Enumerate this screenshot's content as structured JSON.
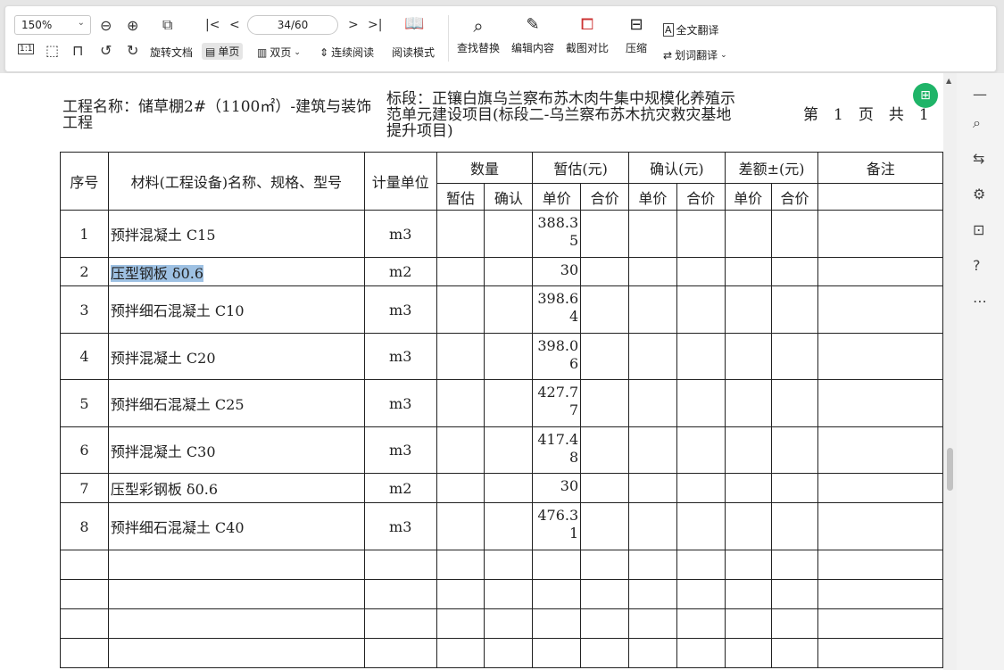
{
  "toolbar": {
    "zoom": "150%",
    "page_indicator": "34/60",
    "row2": {
      "actual_size": "1:1",
      "rotate_doc": "旋转文档",
      "single_page": "单页",
      "double_page": "双页",
      "continuous": "连续阅读",
      "read_mode": "阅读模式"
    },
    "tools": {
      "find_replace": "查找替换",
      "edit_content": "编辑内容",
      "screenshot_compare": "截图对比",
      "compress": "压缩",
      "full_translate": "全文翻译",
      "word_translate": "划词翻译"
    }
  },
  "document": {
    "project_name": "工程名称：储草棚2#（1100㎡）-建筑与装饰工程",
    "project_name_line1": "工程名称：储草棚2#（1100㎡）-建筑与装饰",
    "project_name_line2": "工程",
    "section_line1": "标段：正镶白旗乌兰察布苏木肉牛集中规模化养殖示",
    "section_line2": "范单元建设项目(标段二-乌兰察布苏木抗灾救灾基地",
    "section_line3": "提升项目)",
    "page_info": "第　1　页　共　1",
    "table": {
      "headers": {
        "seq": "序号",
        "material": "材料(工程设备)名称、规格、型号",
        "unit": "计量单位",
        "quantity": "数量",
        "estimate": "暂估(元)",
        "confirm": "确认(元)",
        "difference": "差额±(元)",
        "remark": "备注",
        "qty_est": "暂估",
        "qty_conf": "确认",
        "unit_price": "单价",
        "total_price": "合价"
      },
      "rows": [
        {
          "seq": "1",
          "name": "预拌混凝土 C15",
          "unit": "m3",
          "price": "388.35"
        },
        {
          "seq": "2",
          "name": "压型钢板  δ0.6",
          "unit": "m2",
          "price": "30"
        },
        {
          "seq": "3",
          "name": "预拌细石混凝土 C10",
          "unit": "m3",
          "price": "398.64"
        },
        {
          "seq": "4",
          "name": "预拌混凝土 C20",
          "unit": "m3",
          "price": "398.06"
        },
        {
          "seq": "5",
          "name": "预拌细石混凝土 C25",
          "unit": "m3",
          "price": "427.77"
        },
        {
          "seq": "6",
          "name": "预拌混凝土 C30",
          "unit": "m3",
          "price": "417.48"
        },
        {
          "seq": "7",
          "name": "压型彩钢板  δ0.6",
          "unit": "m2",
          "price": "30"
        },
        {
          "seq": "8",
          "name": "预拌细石混凝土 C40",
          "unit": "m3",
          "price": "476.31"
        }
      ]
    }
  },
  "colors": {
    "selection": "#9ec1e3",
    "float_button": "#1fb468"
  }
}
